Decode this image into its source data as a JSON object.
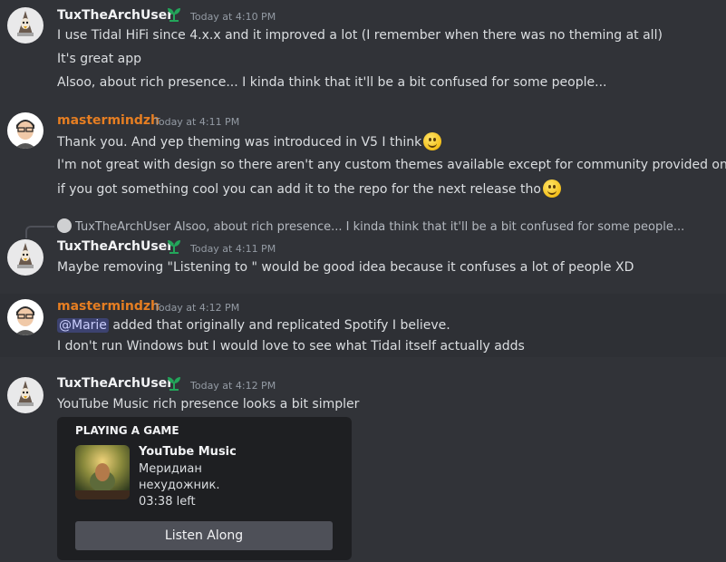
{
  "messages": [
    {
      "author": "TuxTheArchUser",
      "timestamp": "Today at 4:10 PM",
      "lines": [
        "I use Tidal HiFi since 4.x.x and it improved a lot (I remember when there was no theming at all)",
        "It's great app",
        "Alsoo, about rich presence... I kinda think that it'll be a bit confused for some people..."
      ]
    },
    {
      "author": "mastermindzh",
      "timestamp": "Today at 4:11 PM",
      "lines": [
        "Thank you. And yep theming was introduced in V5 I think",
        "I'm not great with design so there aren't any custom themes available except for community provided ones",
        "if you got something cool you can add it to the repo for the next release tho"
      ]
    },
    {
      "reply": {
        "author": "TuxTheArchUser",
        "text": "Alsoo, about rich presence... I kinda think that it'll be a bit confused for some people..."
      },
      "author": "TuxTheArchUser",
      "timestamp": "Today at 4:11 PM",
      "lines": [
        "Maybe removing \"Listening to \" would be good idea because it confuses a lot of people XD"
      ]
    },
    {
      "author": "mastermindzh",
      "timestamp": "Today at 4:12 PM",
      "mention": "@Marie",
      "lines": [
        " added that originally and replicated Spotify I believe.",
        "I don't run Windows but I would love to see what Tidal itself actually adds"
      ]
    },
    {
      "author": "TuxTheArchUser",
      "timestamp": "Today at 4:12 PM",
      "lines": [
        "YouTube Music rich presence looks a bit simpler"
      ],
      "activity": {
        "header": "PLAYING A GAME",
        "name": "YouTube Music",
        "details": "Меридиан",
        "state": "нехудожник.",
        "time_left": "03:38 left",
        "button": "Listen Along"
      }
    }
  ],
  "colors": {
    "background": "#313338",
    "mastermindzh": "#e67e22",
    "badge": "#23a55a"
  },
  "icons": {
    "badge": "sprout-icon",
    "emoji": "slightly-smiling-face"
  }
}
